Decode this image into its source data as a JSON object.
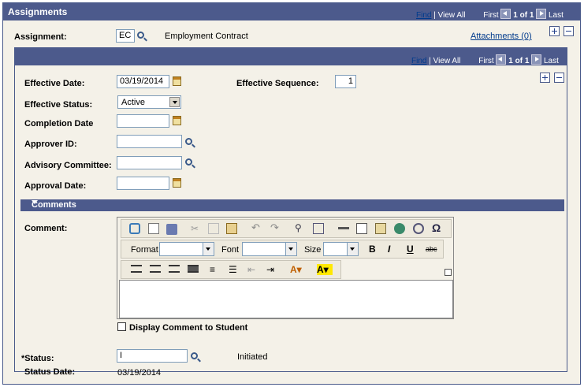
{
  "header": {
    "title": "Assignments"
  },
  "outer_nav": {
    "find": "Find",
    "sep": "|",
    "view_all": "View All",
    "first": "First",
    "count": "1 of 1",
    "last": "Last"
  },
  "inner_nav": {
    "find": "Find",
    "sep": "|",
    "view_all": "View All",
    "first": "First",
    "count": "1 of 1",
    "last": "Last"
  },
  "assignment": {
    "label": "Assignment:",
    "value": "EC",
    "description": "Employment Contract",
    "attachments": "Attachments (0)"
  },
  "form": {
    "effective_date": {
      "label": "Effective Date:",
      "value": "03/19/2014"
    },
    "effective_sequence": {
      "label": "Effective Sequence:",
      "value": "1"
    },
    "effective_status": {
      "label": "Effective Status:",
      "value": "Active"
    },
    "completion_date": {
      "label": "Completion Date",
      "value": ""
    },
    "approver_id": {
      "label": "Approver ID:",
      "value": ""
    },
    "advisory_committee": {
      "label": "Advisory Committee:",
      "value": ""
    },
    "approval_date": {
      "label": "Approval Date:",
      "value": ""
    }
  },
  "comments": {
    "section_title": "Comments",
    "label": "Comment:",
    "format_label": "Format",
    "font_label": "Font",
    "size_label": "Size",
    "display_to_student": "Display Comment to Student"
  },
  "status": {
    "label": "*Status:",
    "value": "I",
    "description": "Initiated",
    "date_label": "Status Date:",
    "date_value": "03/19/2014"
  }
}
